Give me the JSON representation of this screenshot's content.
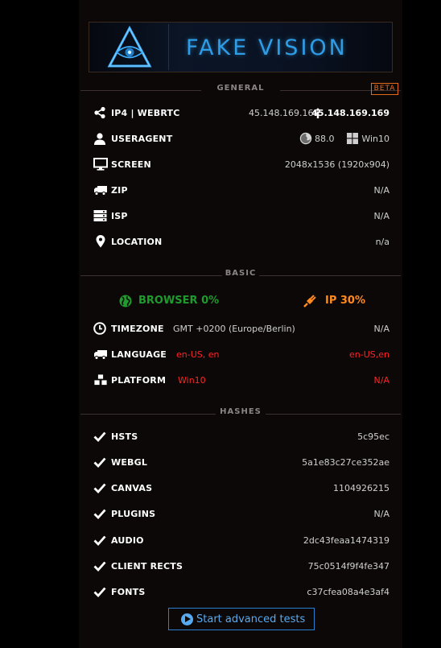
{
  "logo": {
    "title": "FAKE VISION"
  },
  "sections": {
    "general": "GENERAL",
    "basic": "BASIC",
    "hashes": "HASHES"
  },
  "badge": "BETA",
  "general": {
    "ip": {
      "label": "IP4 | WEBRTC",
      "value_ip4": "45.148.169.169",
      "value_webrtc": "45.148.169.169"
    },
    "useragent": {
      "label": "USERAGENT",
      "browser_version": "88.0",
      "os": "Win10"
    },
    "screen": {
      "label": "SCREEN",
      "value": "2048x1536 (1920x904)"
    },
    "zip": {
      "label": "ZIP",
      "value": "N/A"
    },
    "isp": {
      "label": "ISP",
      "value": "N/A"
    },
    "location": {
      "label": "LOCATION",
      "value": "n/a"
    }
  },
  "basic": {
    "browser_score": "BROWSER 0%",
    "ip_score": "IP 30%",
    "timezone": {
      "label": "TIMEZONE",
      "browser": "GMT +0200 (Europe/Berlin)",
      "ip": "N/A"
    },
    "language": {
      "label": "LANGUAGE",
      "browser": "en-US, en",
      "ip": "en-US,en"
    },
    "platform": {
      "label": "PLATFORM",
      "browser": "Win10",
      "ip": "N/A"
    }
  },
  "hashes": [
    {
      "label": "HSTS",
      "value": "5c95ec"
    },
    {
      "label": "WEBGL",
      "value": "5a1e83c27ce352ae"
    },
    {
      "label": "CANVAS",
      "value": "1104926215"
    },
    {
      "label": "PLUGINS",
      "value": "N/A"
    },
    {
      "label": "AUDIO",
      "value": "2dc43feaa1474319"
    },
    {
      "label": "CLIENT RECTS",
      "value": "75c0514f9f4fe347"
    },
    {
      "label": "FONTS",
      "value": "c37cfea08a4e3af4"
    }
  ],
  "actions": {
    "advanced_tests": "Start advanced tests"
  },
  "colors": {
    "accent_blue": "#2f9ce6",
    "good_green": "#1f9a2c",
    "warn_orange": "#ff8a1f",
    "bad_red": "#ff2323",
    "beta_orange": "#e26c1c"
  }
}
